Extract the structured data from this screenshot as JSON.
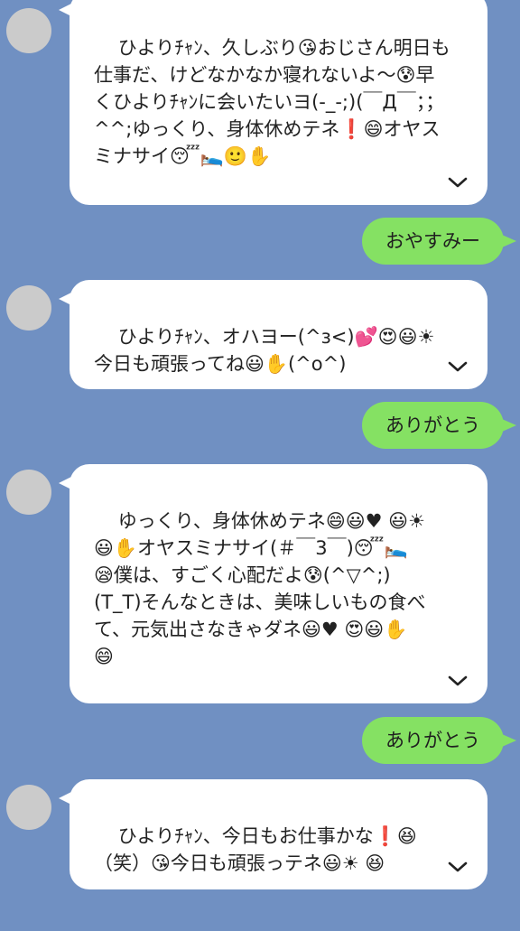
{
  "theme": {
    "background": "#7090c2",
    "incoming_bubble": "#ffffff",
    "outgoing_bubble": "#85e163",
    "avatar_placeholder": "#cbcbcb"
  },
  "messages": [
    {
      "direction": "incoming",
      "text": "ひよりﾁｬﾝ、久しぶり😘おじさん明日も仕事だ、けどなかなか寝れないよ〜😰早くひよりﾁｬﾝに会いたいヨ(-_-;)(￣Д￣；；^^;ゆっくり、身体休めテネ❗😄オヤスミナサイ😴🛌🙂✋",
      "icon": "chevron-down-icon"
    },
    {
      "direction": "outgoing",
      "text": "おやすみー"
    },
    {
      "direction": "incoming",
      "text": "ひよりﾁｬﾝ、オハヨー(^з<)💕😍😃☀\n今日も頑張ってね😃✋(^o^)",
      "icon": "chevron-down-icon"
    },
    {
      "direction": "outgoing",
      "text": "ありがとう"
    },
    {
      "direction": "incoming",
      "text": "ゆっくり、身体休めテネ😄😃♥ 😃☀\n😃✋オヤスミナサイ(＃￣3￣)😴🛌\n😪僕は、すごく心配だよ😰(^▽^;)\n(T_T)そんなときは、美味しいもの食べて、元気出さなきゃダネ😃♥ 😍😃✋\n😄",
      "icon": "chevron-down-icon"
    },
    {
      "direction": "outgoing",
      "text": "ありがとう"
    },
    {
      "direction": "incoming",
      "text": "ひよりﾁｬﾝ、今日もお仕事かな❗😆\n（笑）😘今日も頑張っテネ😃☀ 😆",
      "icon": "chevron-down-icon"
    }
  ]
}
